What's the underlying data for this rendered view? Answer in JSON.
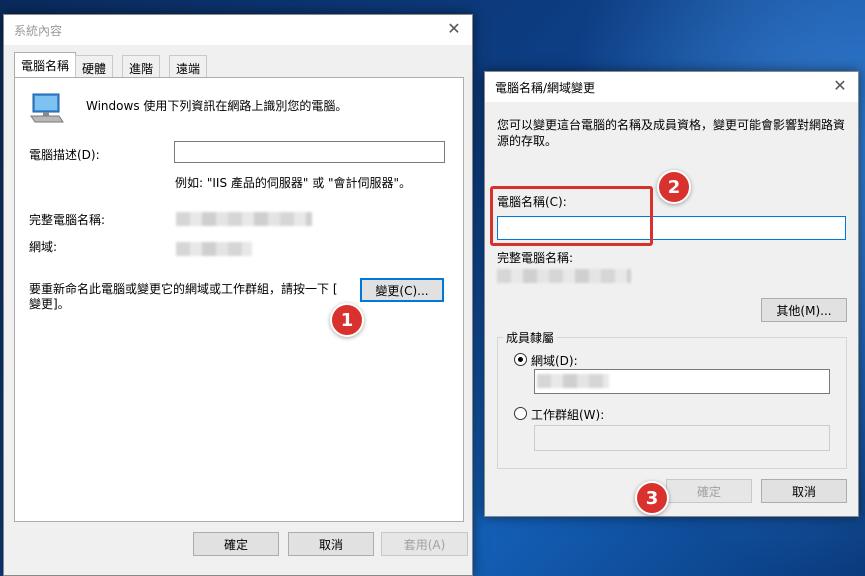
{
  "system_props": {
    "title": "系統內容",
    "tabs": [
      "電腦名稱",
      "硬體",
      "進階",
      "遠端"
    ],
    "intro": "Windows 使用下列資訊在網路上識別您的電腦。",
    "description_label": "電腦描述(D):",
    "description_value": "",
    "example": "例如: \"IIS 產品的伺服器\" 或 \"會計伺服器\"。",
    "full_name_label": "完整電腦名稱:",
    "domain_label": "網域:",
    "rename_text_1": "要重新命名此電腦或變更它的網域或工作群組，請按一下 [",
    "rename_text_2": "變更]。",
    "change_button": "變更(C)...",
    "ok_button": "確定",
    "cancel_button": "取消",
    "apply_button": "套用(A)"
  },
  "rename_dialog": {
    "title": "電腦名稱/網域變更",
    "intro_1": "您可以變更這台電腦的名稱及成員資格，變更可能會影響對網路資",
    "intro_2": "源的存取。",
    "computer_name_label": "電腦名稱(C):",
    "computer_name_value": "",
    "full_name_label": "完整電腦名稱:",
    "more_button": "其他(M)...",
    "membership_label": "成員隸屬",
    "domain_radio": "網域(D):",
    "workgroup_radio": "工作群組(W):",
    "ok_button": "確定",
    "cancel_button": "取消"
  },
  "badges": [
    "1",
    "2",
    "3"
  ],
  "colors": {
    "highlight_box": "#d9312e",
    "focus_border": "#0078d7"
  }
}
